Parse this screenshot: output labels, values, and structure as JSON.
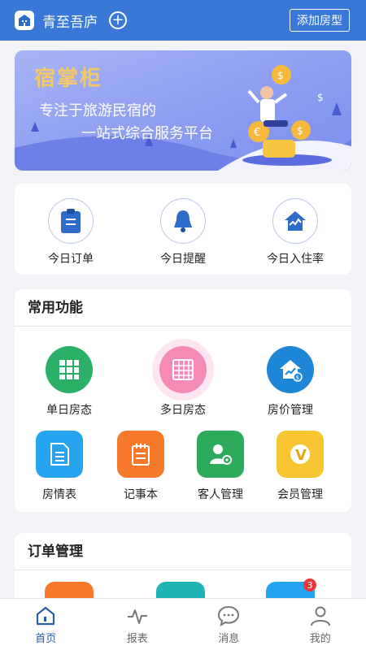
{
  "header": {
    "title": "青至吾庐",
    "add_room_label": "添加房型"
  },
  "banner": {
    "brand": "宿掌柜",
    "line1": "专注于旅游民宿的",
    "line2": "一站式综合服务平台"
  },
  "quick": [
    {
      "label": "今日订单",
      "icon": "clipboard-icon"
    },
    {
      "label": "今日提醒",
      "icon": "bell-icon"
    },
    {
      "label": "今日入住率",
      "icon": "house-chart-icon"
    }
  ],
  "common": {
    "title": "常用功能",
    "items": [
      {
        "label": "单日房态",
        "icon": "grid-icon",
        "color": "#2bb067"
      },
      {
        "label": "多日房态",
        "icon": "calendar-grid-icon",
        "color": "#f58ab4"
      },
      {
        "label": "房价管理",
        "icon": "price-house-icon",
        "color": "#1e86d6"
      },
      {
        "label": "房情表",
        "icon": "document-icon",
        "color": "#27a4ef"
      },
      {
        "label": "记事本",
        "icon": "notebook-icon",
        "color": "#f7792a"
      },
      {
        "label": "客人管理",
        "icon": "guest-gear-icon",
        "color": "#2daa5a"
      },
      {
        "label": "会员管理",
        "icon": "vip-icon",
        "color": "#f6c531"
      }
    ]
  },
  "orders": {
    "title": "订单管理",
    "badge": "3"
  },
  "tabs": [
    {
      "label": "首页",
      "icon": "home-icon",
      "active": true
    },
    {
      "label": "报表",
      "icon": "pulse-icon",
      "active": false
    },
    {
      "label": "消息",
      "icon": "chat-icon",
      "active": false
    },
    {
      "label": "我的",
      "icon": "user-icon",
      "active": false
    }
  ]
}
